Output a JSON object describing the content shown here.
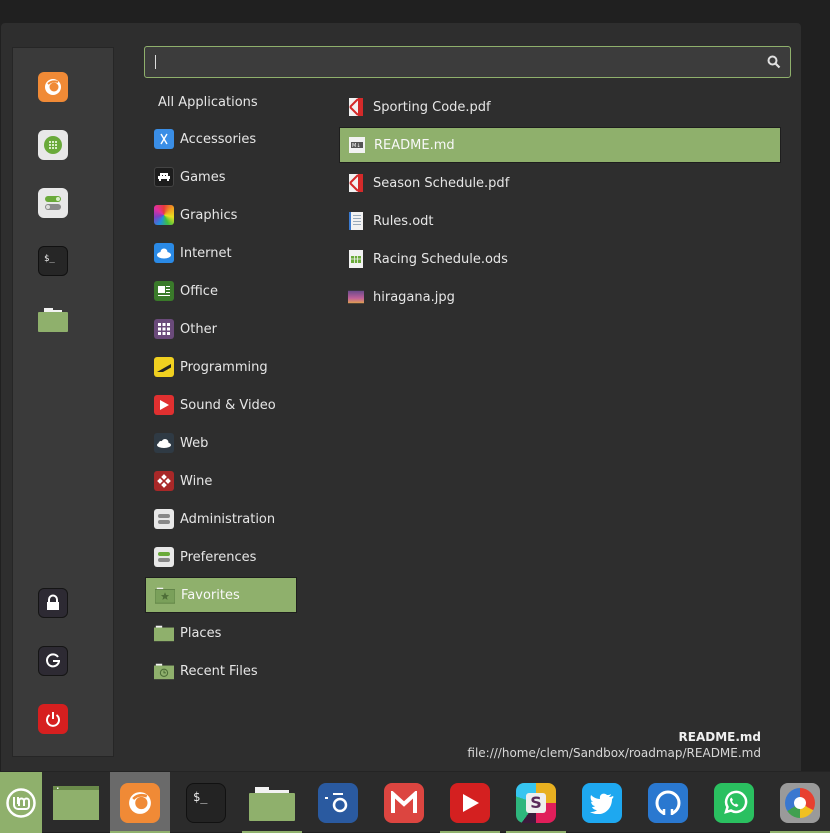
{
  "colors": {
    "accent": "#8fb06c",
    "menu_bg": "#2e2e2e",
    "panel_bg": "#3a3a3a",
    "taskbar_bg": "#2b2b2b"
  },
  "side_panel": {
    "favorites": [
      {
        "name": "Firefox",
        "icon": "firefox-icon"
      },
      {
        "name": "Software Manager",
        "icon": "software-manager-icon"
      },
      {
        "name": "System Settings",
        "icon": "settings-toggle-icon"
      },
      {
        "name": "Terminal",
        "icon": "terminal-icon"
      },
      {
        "name": "Files",
        "icon": "folder-icon"
      }
    ],
    "session": [
      {
        "name": "Lock Screen",
        "icon": "lock-icon"
      },
      {
        "name": "Logout",
        "icon": "logout-icon"
      },
      {
        "name": "Quit",
        "icon": "power-icon"
      }
    ]
  },
  "search": {
    "value": "",
    "placeholder": "",
    "icon": "search-icon"
  },
  "categories": {
    "all_label": "All Applications",
    "items": [
      {
        "label": "Accessories",
        "icon": "accessories-icon"
      },
      {
        "label": "Games",
        "icon": "games-icon"
      },
      {
        "label": "Graphics",
        "icon": "graphics-icon"
      },
      {
        "label": "Internet",
        "icon": "internet-icon"
      },
      {
        "label": "Office",
        "icon": "office-icon"
      },
      {
        "label": "Other",
        "icon": "other-icon"
      },
      {
        "label": "Programming",
        "icon": "programming-icon"
      },
      {
        "label": "Sound & Video",
        "icon": "sound-video-icon"
      },
      {
        "label": "Web",
        "icon": "web-icon"
      },
      {
        "label": "Wine",
        "icon": "wine-icon"
      },
      {
        "label": "Administration",
        "icon": "administration-icon"
      },
      {
        "label": "Preferences",
        "icon": "preferences-icon"
      },
      {
        "label": "Favorites",
        "icon": "favorites-folder-icon",
        "selected": true
      },
      {
        "label": "Places",
        "icon": "places-folder-icon"
      },
      {
        "label": "Recent Files",
        "icon": "recent-files-folder-icon"
      }
    ]
  },
  "files": [
    {
      "label": "Sporting Code.pdf",
      "icon": "pdf-icon"
    },
    {
      "label": "README.md",
      "icon": "markdown-icon",
      "selected": true
    },
    {
      "label": "Season Schedule.pdf",
      "icon": "pdf-icon"
    },
    {
      "label": "Rules.odt",
      "icon": "text-document-icon"
    },
    {
      "label": "Racing Schedule.ods",
      "icon": "spreadsheet-icon"
    },
    {
      "label": "hiragana.jpg",
      "icon": "image-icon"
    }
  ],
  "info": {
    "name": "README.md",
    "path": "file:///home/clem/Sandbox/roadmap/README.md"
  },
  "taskbar": {
    "items": [
      {
        "name": "Menu",
        "icon": "mint-logo-icon",
        "active": true
      },
      {
        "name": "Show Desktop",
        "icon": "show-desktop-icon"
      },
      {
        "name": "Firefox",
        "icon": "firefox-icon",
        "running": true,
        "focused": true
      },
      {
        "name": "Terminal",
        "icon": "terminal-icon"
      },
      {
        "name": "Files",
        "icon": "folder-icon",
        "running": true
      },
      {
        "name": "Screenshot",
        "icon": "camera-icon"
      },
      {
        "name": "Gmail",
        "icon": "gmail-icon"
      },
      {
        "name": "YouTube",
        "icon": "youtube-icon",
        "running": true
      },
      {
        "name": "Slack",
        "icon": "slack-icon",
        "running": true
      },
      {
        "name": "Twitter",
        "icon": "twitter-icon"
      },
      {
        "name": "GitHub",
        "icon": "github-icon"
      },
      {
        "name": "WhatsApp",
        "icon": "whatsapp-icon"
      },
      {
        "name": "Chrome",
        "icon": "chrome-icon",
        "running": true
      }
    ]
  }
}
